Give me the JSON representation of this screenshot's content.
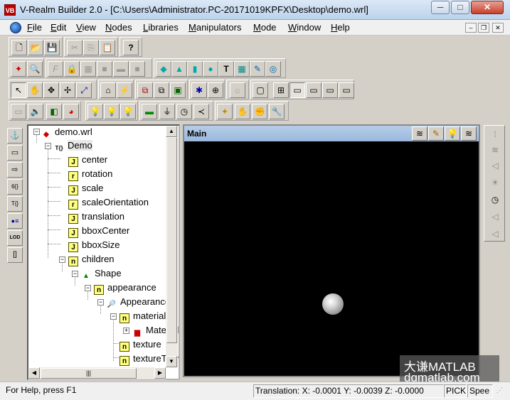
{
  "window": {
    "title": "V-Realm Builder 2.0 - [C:\\Users\\Administrator.PC-20171019KPFX\\Desktop\\demo.wrl]",
    "controls": {
      "minimize": "─",
      "maximize": "□",
      "close": "✕"
    }
  },
  "menu": {
    "items": [
      "File",
      "Edit",
      "View",
      "Nodes",
      "Libraries",
      "Manipulators",
      "Mode",
      "Window",
      "Help"
    ],
    "mdi": {
      "minimize": "–",
      "restore": "❐",
      "close": "✕"
    }
  },
  "toolbar1": [
    "new-file-icon",
    "open-folder-icon",
    "save-icon",
    "cut-icon",
    "copy-icon",
    "paste-icon",
    "help-icon"
  ],
  "toolbar1_glyphs": [
    "🗋",
    "📂",
    "💾",
    "✂",
    "⎘",
    "📋",
    "?"
  ],
  "toolbar2_glyphs": [
    "✦",
    "🔍",
    "F",
    "🔒",
    "▦",
    "■",
    "▬",
    "■",
    "◆",
    "▲",
    "▮",
    "●",
    "T",
    "▦",
    "✎",
    "◎"
  ],
  "toolbar3_glyphs": [
    "↖",
    "✋",
    "✥",
    "✢",
    "⤢",
    "⌂",
    "⚡",
    "⧉",
    "⧉",
    "▣",
    "✱",
    "⊕",
    "☼",
    "▢",
    "⊞",
    "▭",
    "▭",
    "▭",
    "▭"
  ],
  "toolbar4_glyphs": [
    "▭",
    "🔈",
    "◧",
    "◕",
    "💡",
    "💡",
    "💡",
    "▬",
    "⏚",
    "◷",
    "≺",
    "✦",
    "✋",
    "✊",
    "🔧"
  ],
  "left_toolbar_glyphs": [
    "⚓",
    "▭",
    "⇨",
    "6{}",
    "T{}",
    "●≡",
    "LOD",
    "[]"
  ],
  "right_toolbar_glyphs": [
    "⁞",
    "≋",
    "◁",
    "☀",
    "◷",
    "◁",
    "◁"
  ],
  "tree": {
    "root": "demo.wrl",
    "nodes": [
      {
        "label": "Demo",
        "icon": "T{}"
      },
      {
        "label": "center",
        "icon": "J"
      },
      {
        "label": "rotation",
        "icon": "r"
      },
      {
        "label": "scale",
        "icon": "J"
      },
      {
        "label": "scaleOrientation",
        "icon": "r"
      },
      {
        "label": "translation",
        "icon": "J"
      },
      {
        "label": "bboxCenter",
        "icon": "J"
      },
      {
        "label": "bboxSize",
        "icon": "J"
      },
      {
        "label": "children",
        "icon": "n"
      },
      {
        "label": "Shape",
        "icon": "shape"
      },
      {
        "label": "appearance",
        "icon": "n"
      },
      {
        "label": "Appearance",
        "icon": "search"
      },
      {
        "label": "material",
        "icon": "n"
      },
      {
        "label": "Material",
        "icon": "mat"
      },
      {
        "label": "texture",
        "icon": "n"
      },
      {
        "label": "textureTransform",
        "icon": "n"
      }
    ]
  },
  "view": {
    "title": "Main",
    "buttons": [
      "≋",
      "✎",
      "💡",
      "≋"
    ]
  },
  "watermark": {
    "line1": "大谦MATLAB",
    "line2": "dqmatlab.com"
  },
  "status": {
    "help": "For Help, press F1",
    "translation": "Translation: X: -0.0001  Y: -0.0039  Z: -0.0000",
    "mode": "PICK",
    "speed": "Spee"
  }
}
